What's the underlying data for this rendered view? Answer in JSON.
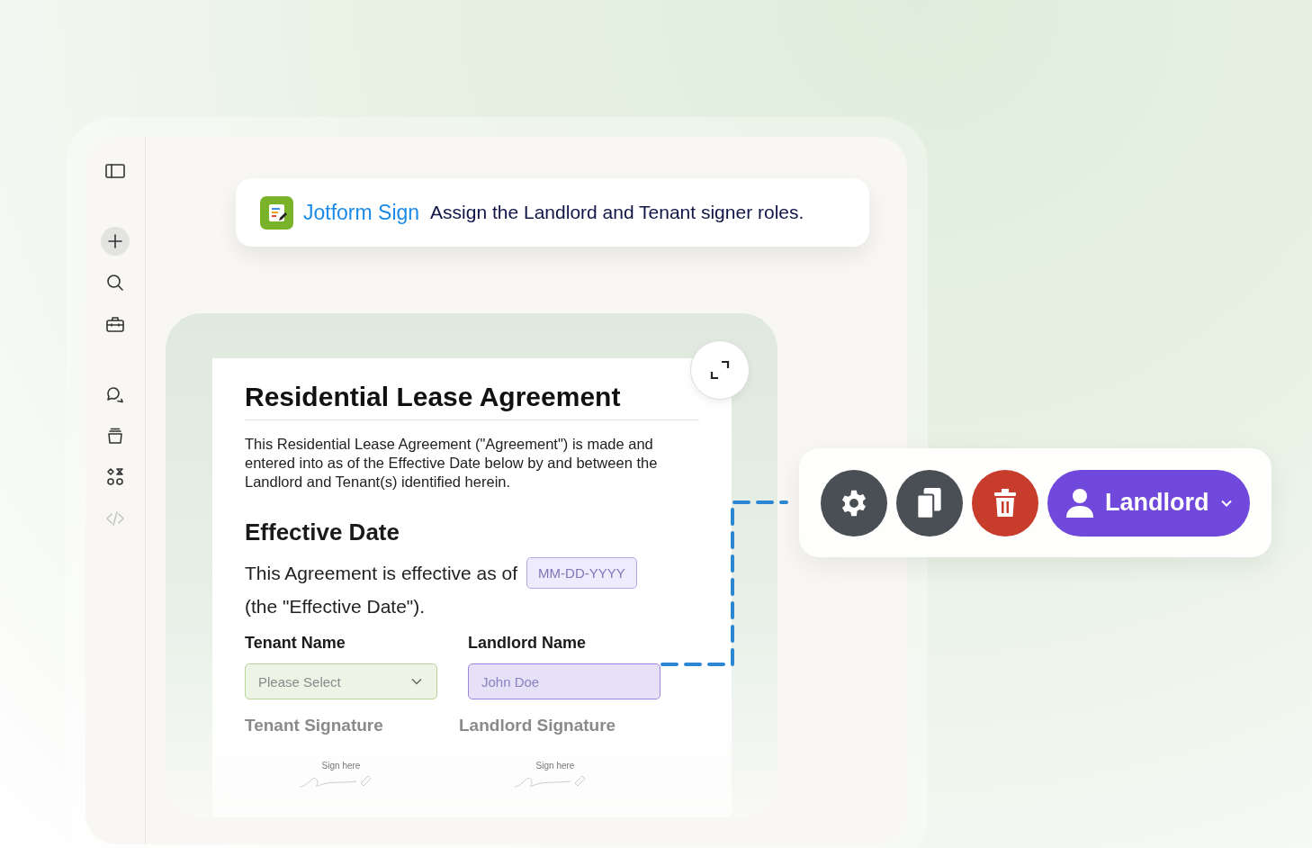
{
  "sidebar": {
    "items": [
      {
        "selected": false,
        "disabled": false
      },
      {
        "selected": true,
        "disabled": false
      },
      {
        "selected": false,
        "disabled": false
      },
      {
        "selected": false,
        "disabled": false
      },
      {
        "selected": false,
        "disabled": false
      },
      {
        "selected": false,
        "disabled": false
      },
      {
        "selected": false,
        "disabled": false
      },
      {
        "selected": false,
        "disabled": true
      }
    ]
  },
  "banner": {
    "brand": "Jotform Sign",
    "message": "Assign the Landlord and Tenant signer roles."
  },
  "document": {
    "title": "Residential Lease Agreement",
    "intro": "This Residential Lease Agreement (\"Agreement\") is made and entered into as of the Effective Date below by and between the Landlord and Tenant(s) identified herein.",
    "section_title": "Effective Date",
    "effective_before": "This Agreement is effective as of",
    "date_field": {
      "placeholder": "MM-DD-YYYY"
    },
    "effective_after": "(the \"Effective Date\").",
    "fields": [
      {
        "label": "Tenant Name",
        "kind": "dropdown",
        "placeholder": "Please Select",
        "color": "#b9d49c"
      },
      {
        "label": "Landlord Name",
        "kind": "text",
        "placeholder": "John Doe",
        "color": "#9a86e0"
      }
    ],
    "signatures": [
      {
        "label": "Tenant Signature",
        "hint": "Sign here"
      },
      {
        "label": "Landlord Signature",
        "hint": "Sign here"
      }
    ]
  },
  "toolbar": {
    "actions": [
      {
        "kind": "settings"
      },
      {
        "kind": "duplicate"
      },
      {
        "kind": "delete"
      }
    ],
    "role": {
      "label": "Landlord"
    }
  }
}
